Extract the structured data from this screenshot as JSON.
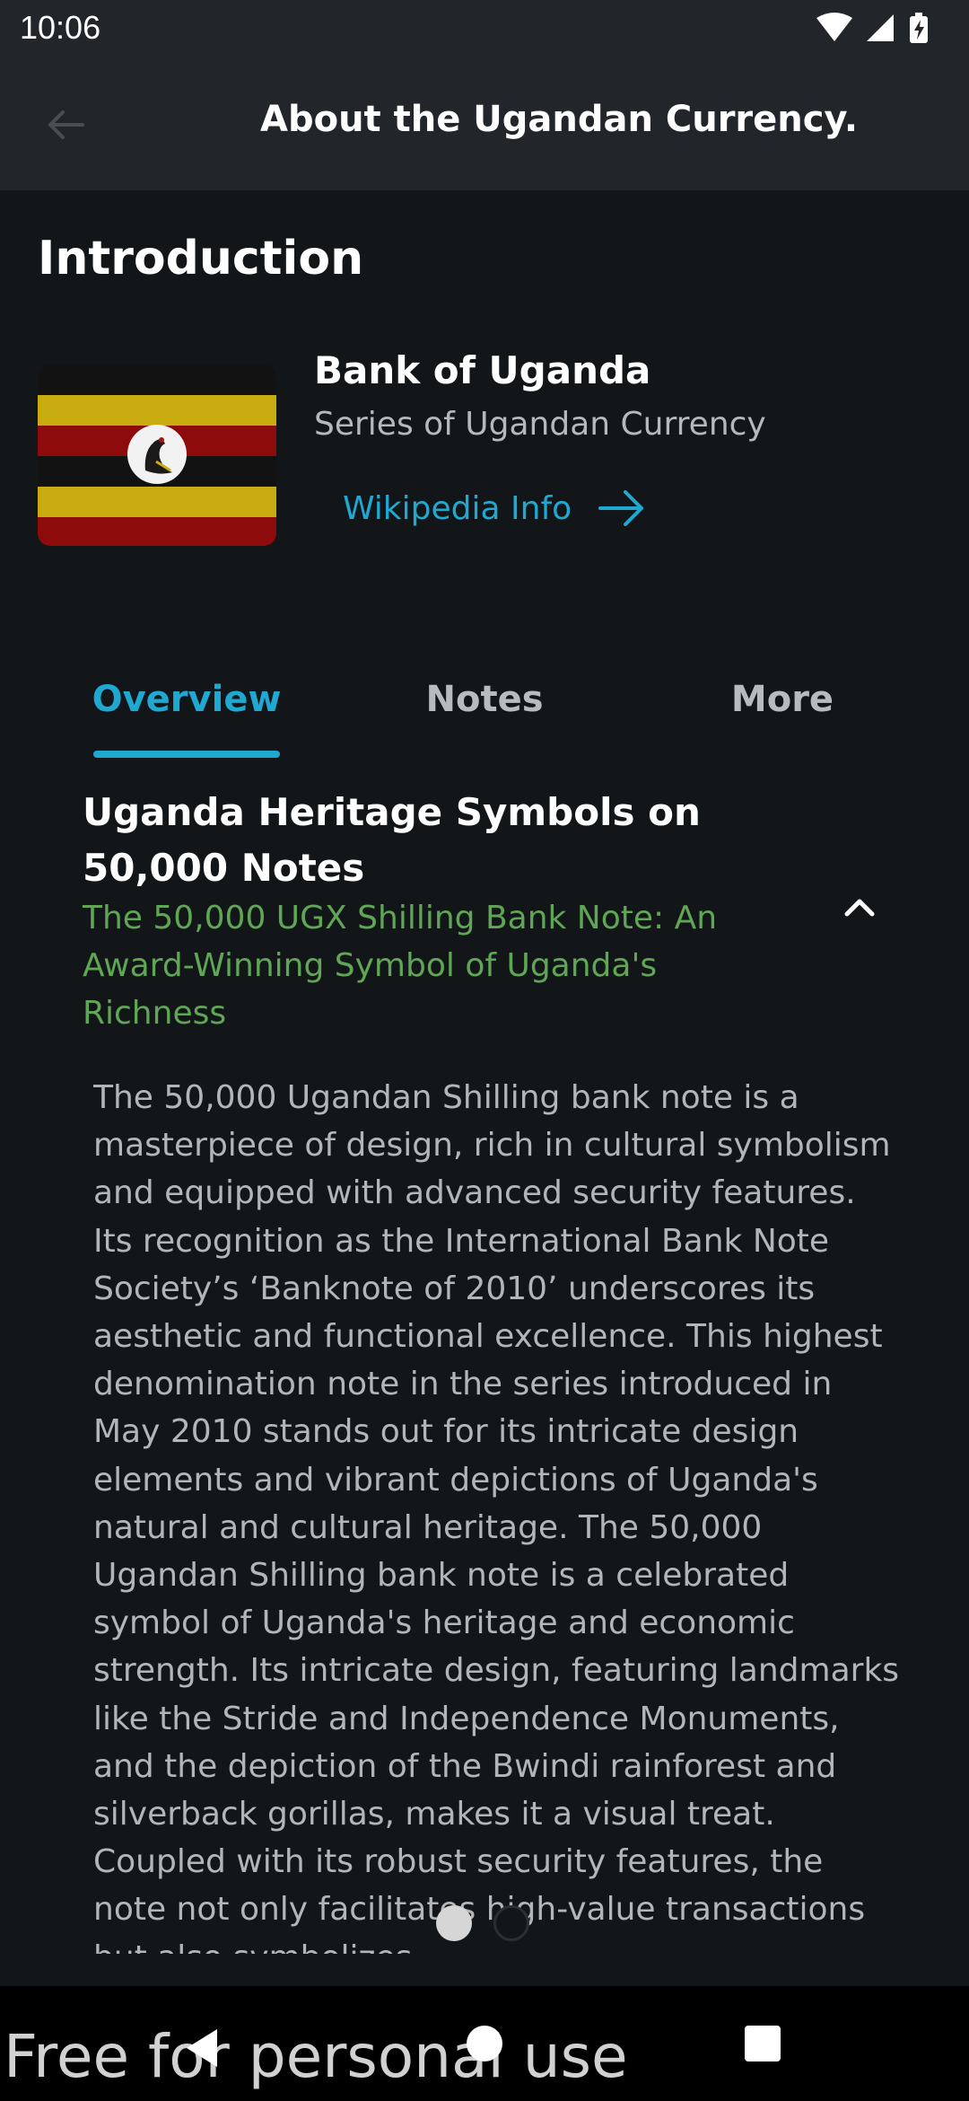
{
  "status_bar": {
    "time": "10:06",
    "icons": [
      "wifi-icon",
      "signal-icon",
      "battery-charging-icon"
    ]
  },
  "app_bar": {
    "title": "About the Ugandan Currency.",
    "back_icon": "arrow-left-icon"
  },
  "intro": {
    "heading": "Introduction",
    "bank_name": "Bank of Uganda",
    "bank_subtitle": "Series of Ugandan Currency",
    "wiki_label": "Wikipedia Info",
    "wiki_icon": "arrow-right-icon",
    "flag_colors": {
      "black": "#121212",
      "yellow": "#c9ad10",
      "red": "#8e0b0b"
    }
  },
  "tabs": [
    {
      "label": "Overview",
      "active": true
    },
    {
      "label": "Notes",
      "active": false
    },
    {
      "label": "More",
      "active": false
    }
  ],
  "card": {
    "title": "Uganda Heritage Symbols on 50,000 Notes",
    "subtitle": "The 50,000 UGX Shilling Bank Note: An Award-Winning Symbol of Uganda's Richness",
    "collapse_icon": "chevron-up-icon",
    "body": "The 50,000 Ugandan Shilling bank note is a masterpiece of design, rich in cultural symbolism and equipped with advanced security features. Its recognition as the International Bank Note Society’s ‘Banknote of 2010’ underscores its aesthetic and functional excellence. This highest denomination note in the series introduced in May 2010 stands out for its intricate design elements and vibrant depictions of Uganda's natural and cultural heritage. The 50,000 Ugandan Shilling bank note is a celebrated symbol of Uganda's heritage and economic strength. Its intricate design, featuring landmarks like the Stride and Independence Monuments, and the depiction of the Bwindi rainforest and silverback gorillas, makes it a visual treat. Coupled with its robust security features, the note not only facilitates high-value transactions but also symbolizes"
  },
  "pager": {
    "count": 2,
    "active_index": 0
  },
  "nav_bar": {
    "icons": [
      "nav-back-icon",
      "nav-home-icon",
      "nav-recents-icon"
    ]
  },
  "watermark": "Free for personal use",
  "colors": {
    "accent": "#1fa9d2",
    "subtitle_green": "#5fa655",
    "background": "#131619",
    "app_bar": "#22262b"
  }
}
